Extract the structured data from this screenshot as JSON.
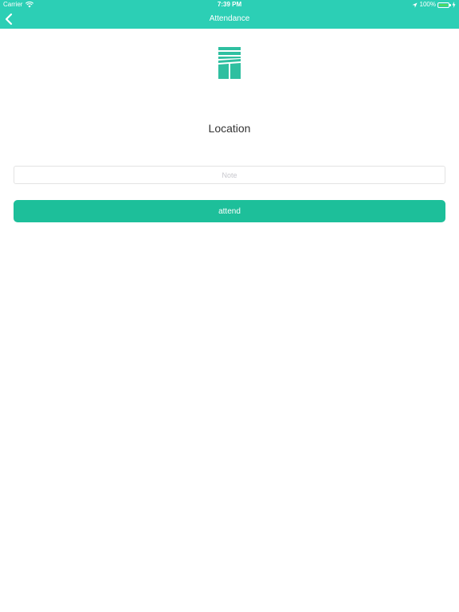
{
  "status_bar": {
    "carrier": "Carrier",
    "time": "7:39 PM",
    "battery_percent": "100%",
    "battery_level": 1.0,
    "icons": [
      "wifi-icon",
      "location-arrow-icon",
      "battery-icon",
      "charging-icon"
    ]
  },
  "nav": {
    "title": "Attendance",
    "back_icon": "chevron-left-icon"
  },
  "main": {
    "logo_icon": "building-logo-icon",
    "location_label": "Location",
    "note_placeholder": "Note",
    "note_value": "",
    "attend_label": "attend"
  },
  "colors": {
    "header": "#2ccfb5",
    "button": "#1dbf9a",
    "logo": "#2fbfa0",
    "battery": "#4cd964"
  }
}
